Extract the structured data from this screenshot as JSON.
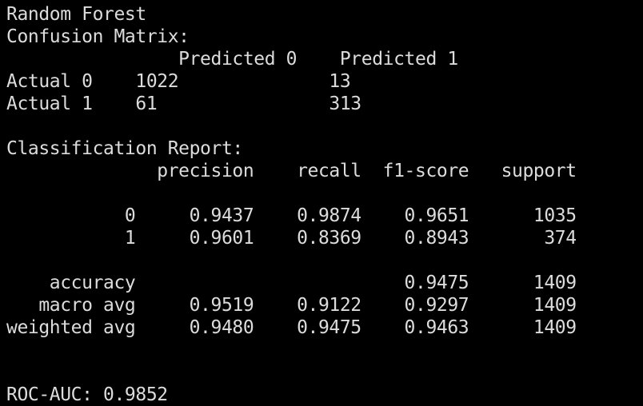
{
  "colors": {
    "background": "#000000",
    "text": "#dcdcdc"
  },
  "terminal": {
    "lines": [
      "Random Forest",
      "Confusion Matrix:",
      "                Predicted 0    Predicted 1",
      "Actual 0    1022              13",
      "Actual 1    61                313",
      "",
      "Classification Report:",
      "              precision    recall  f1-score   support",
      "",
      "           0     0.9437    0.9874    0.9651      1035",
      "           1     0.9601    0.8369    0.8943       374",
      "",
      "    accuracy                         0.9475      1409",
      "   macro avg     0.9519    0.9122    0.9297      1409",
      "weighted avg     0.9480    0.9475    0.9463      1409",
      "",
      "",
      "ROC-AUC: 0.9852"
    ]
  }
}
